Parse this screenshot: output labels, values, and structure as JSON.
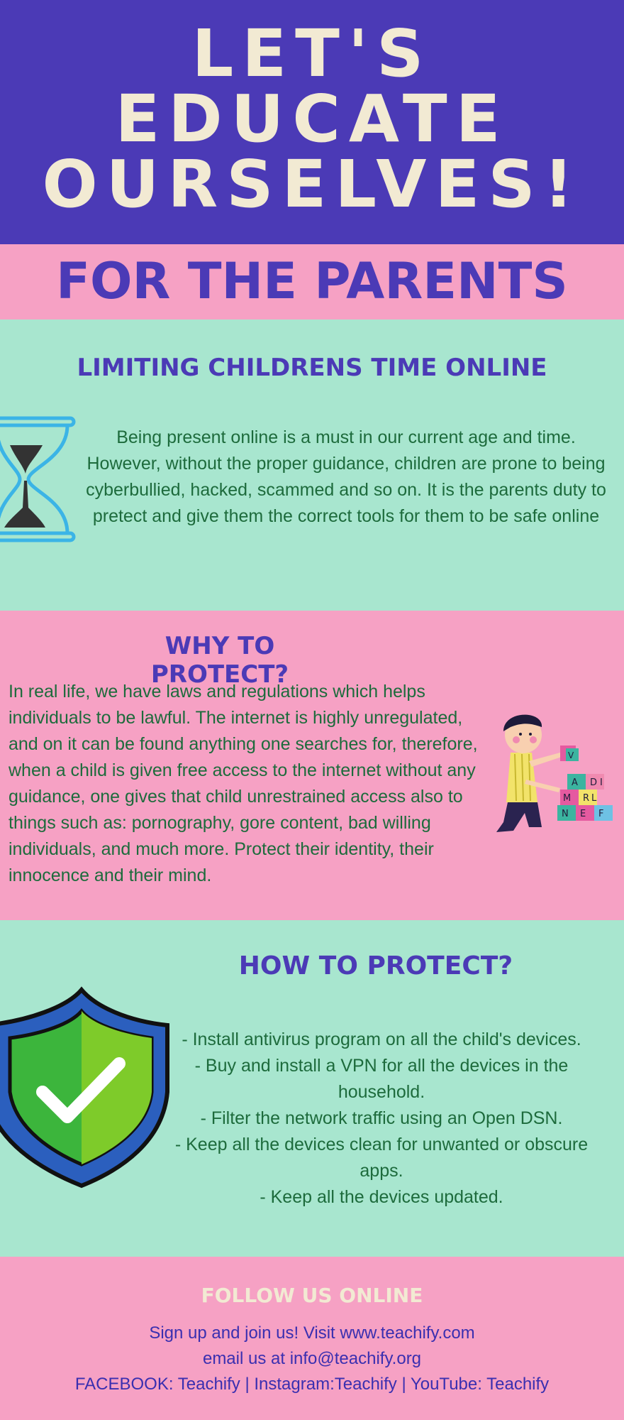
{
  "hero": {
    "title_lines": [
      "LET'S",
      "EDUCATE",
      "OURSELVES!"
    ]
  },
  "parents": {
    "heading": "FOR THE PARENTS"
  },
  "limit": {
    "heading": "LIMITING CHILDRENS TIME ONLINE",
    "lines": [
      "Being present online is a must in our current age and time.",
      "However, without the proper guidance, children are prone to being",
      "cyberbullied, hacked, scammed and so on. It is the parents duty to",
      "pretect and give them the correct tools for them to be safe online"
    ],
    "icon": "hourglass-icon"
  },
  "why": {
    "heading": "WHY TO PROTECT?",
    "lines": [
      "In real life, we have laws and regulations which helps",
      "individuals to be lawful. The internet is highly unregulated,",
      "and on it can be found anything one searches for, therefore,",
      "when a child is given free access to the internet without any",
      "guidance, one gives that child unrestrained access also to",
      "things such as: pornography, gore content, bad willing",
      "individuals, and much more. Protect their identity, their",
      "innocence and their mind."
    ],
    "illustration": "child-with-blocks-illustration",
    "block_letters": [
      "V",
      "A",
      "D",
      "I",
      "M",
      "R",
      "L",
      "N",
      "E",
      "F"
    ]
  },
  "how": {
    "heading": "HOW TO PROTECT?",
    "lines": [
      "- Install antivirus program on all the child's devices.",
      "- Buy and install a VPN for all the devices in the",
      "household.",
      "- Filter the network traffic using an Open DSN.",
      "- Keep all the devices clean for unwanted or obscure",
      "apps.",
      "- Keep all the devices updated."
    ],
    "icon": "shield-check-icon"
  },
  "follow": {
    "heading": "FOLLOW US ONLINE",
    "lines": [
      "Sign up and join us! Visit www.teachify.com",
      "email us at info@teachify.org",
      "FACEBOOK: Teachify | Instagram:Teachify | YouTube: Teachify"
    ]
  },
  "colors": {
    "purple": "#4b3ab6",
    "pink": "#f6a1c4",
    "mint": "#a8e6cf",
    "cream": "#f2ead3",
    "green_text": "#1d6b3c"
  }
}
